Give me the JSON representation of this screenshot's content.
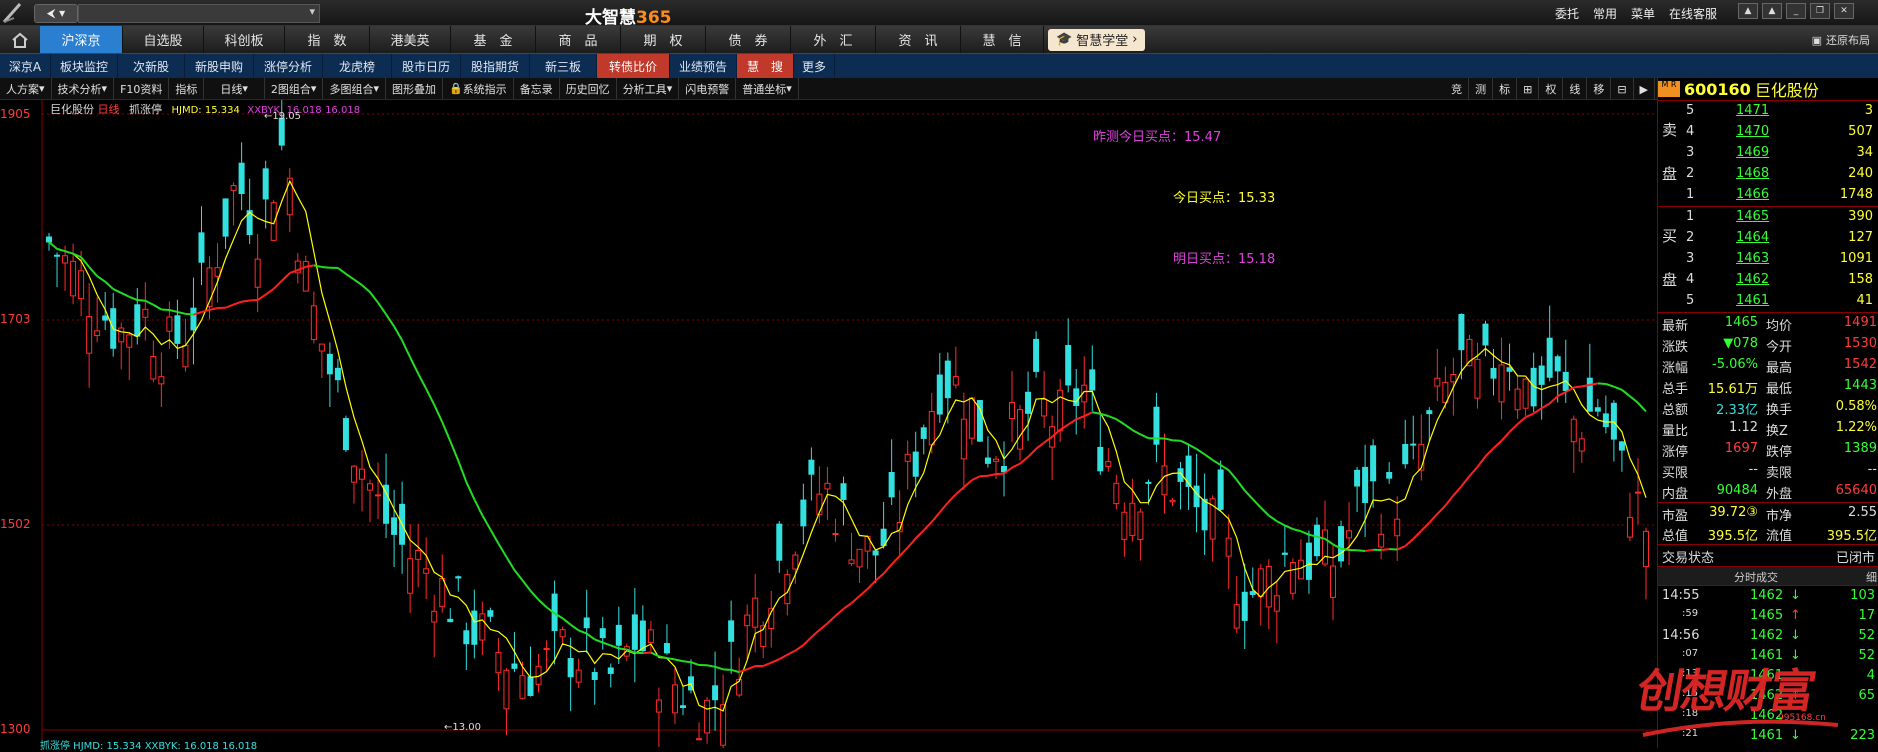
{
  "app": {
    "title": "大智慧365",
    "title_main": "大智慧",
    "title_suffix": "365",
    "window_controls": [
      "委托",
      "常用",
      "菜单",
      "在线客服"
    ],
    "restore_layout": "还原布局"
  },
  "menu": {
    "items": [
      "沪深京",
      "自选股",
      "科创板",
      "指　数",
      "港美英",
      "基　金",
      "商　品",
      "期　权",
      "债　券",
      "外　汇",
      "资　讯",
      "慧　信"
    ],
    "academy": "智慧学堂"
  },
  "subnav": {
    "items": [
      "深京A",
      "板块监控",
      "次新股",
      "新股申购",
      "涨停分析",
      "龙虎榜",
      "股市日历",
      "股指期货",
      "新三板",
      "转债比价",
      "业绩预告",
      "慧　搜",
      "更多"
    ]
  },
  "toolbar": {
    "items": [
      "人方案",
      "技术分析",
      "F10资料",
      "指标",
      "日线",
      "2图组合",
      "多图组合",
      "图形叠加",
      "系统指示",
      "备忘录",
      "历史回忆",
      "分析工具",
      "闪电预警",
      "普通坐标"
    ],
    "right_buttons": [
      "竞",
      "测",
      "标",
      "⊞",
      "权",
      "线",
      "移",
      "⊟",
      "▶"
    ]
  },
  "chart": {
    "stock_label": "巨化股份",
    "period": "日线",
    "indicator": "抓涨停",
    "hjmd": "HJMD: 15.334",
    "xxbyk": "XXBYK: 16.018",
    "xxbyk2": "16.018",
    "price_labels": [
      "1905",
      "1703",
      "1502",
      "1300"
    ],
    "high_marker": "19.05",
    "low_marker": "13.00",
    "note_yesterday": "昨测今日买点：15.47",
    "note_today": "今日买点：15.33",
    "note_tomorrow": "明日买点：15.18",
    "bottom_indicator": "抓涨停  HJMD: 15.334   XXBYK: 16.018   16.018",
    "colors": {
      "up": "#ff2a2a",
      "down": "#33e0e0",
      "ma_fast": "#ffff00",
      "ma_up": "#ff2020",
      "ma_down": "#22dd22"
    }
  },
  "chart_data": {
    "type": "candlestick",
    "ylim": [
      13.0,
      19.05
    ],
    "close_trend": [
      17.8,
      17.5,
      17.2,
      16.9,
      17.1,
      16.7,
      17.0,
      17.6,
      18.4,
      17.9,
      18.8,
      17.3,
      16.5,
      15.8,
      15.2,
      14.8,
      14.6,
      14.3,
      14.0,
      13.8,
      13.6,
      13.6,
      13.8,
      13.7,
      13.5,
      13.9,
      13.6,
      13.4,
      13.2,
      13.6,
      14.2,
      14.6,
      15.1,
      15.4,
      15.0,
      14.7,
      15.0,
      15.8,
      16.5,
      16.3,
      15.8,
      15.9,
      16.2,
      16.0,
      16.4,
      15.7,
      15.3,
      15.6,
      15.4,
      15.1,
      14.8,
      14.3,
      14.5,
      14.8,
      14.6,
      14.7,
      15.4,
      15.2,
      15.5,
      16.1,
      16.6,
      16.4,
      16.8,
      16.3,
      16.5,
      16.0,
      16.2,
      15.5,
      15.0
    ],
    "high": 19.05,
    "low": 13.0
  },
  "quote": {
    "code": "600160",
    "name": "巨化股份",
    "ask_label": [
      "卖",
      "盘"
    ],
    "bid_label": [
      "买",
      "盘"
    ],
    "asks": [
      {
        "level": "5",
        "price": "1471",
        "vol": "3"
      },
      {
        "level": "4",
        "price": "1470",
        "vol": "507"
      },
      {
        "level": "3",
        "price": "1469",
        "vol": "34"
      },
      {
        "level": "2",
        "price": "1468",
        "vol": "240"
      },
      {
        "level": "1",
        "price": "1466",
        "vol": "1748"
      }
    ],
    "bids": [
      {
        "level": "1",
        "price": "1465",
        "vol": "390"
      },
      {
        "level": "2",
        "price": "1464",
        "vol": "127"
      },
      {
        "level": "3",
        "price": "1463",
        "vol": "1091"
      },
      {
        "level": "4",
        "price": "1462",
        "vol": "158"
      },
      {
        "level": "5",
        "price": "1461",
        "vol": "41"
      }
    ],
    "stats": [
      {
        "l1": "最新",
        "v1": "1465",
        "c1": "green",
        "l2": "均价",
        "v2": "1491",
        "c2": "red"
      },
      {
        "l1": "涨跌",
        "v1": "▼078",
        "c1": "green",
        "l2": "今开",
        "v2": "1530",
        "c2": "red"
      },
      {
        "l1": "涨幅",
        "v1": "-5.06%",
        "c1": "green",
        "l2": "最高",
        "v2": "1542",
        "c2": "red"
      },
      {
        "l1": "总手",
        "v1": "15.61万",
        "c1": "yellow",
        "l2": "最低",
        "v2": "1443",
        "c2": "green"
      },
      {
        "l1": "总额",
        "v1": "2.33亿",
        "c1": "cyan",
        "l2": "换手",
        "v2": "0.58%",
        "c2": "yellow"
      },
      {
        "l1": "量比",
        "v1": "1.12",
        "c1": "white",
        "l2": "换Z",
        "v2": "1.22%",
        "c2": "yellow"
      },
      {
        "l1": "涨停",
        "v1": "1697",
        "c1": "red",
        "l2": "跌停",
        "v2": "1389",
        "c2": "green"
      },
      {
        "l1": "买限",
        "v1": "--",
        "c1": "white",
        "l2": "卖限",
        "v2": "--",
        "c2": "white"
      },
      {
        "l1": "内盘",
        "v1": "90484",
        "c1": "green",
        "l2": "外盘",
        "v2": "65640",
        "c2": "red"
      },
      {
        "l1": "市盈",
        "v1": "39.72③",
        "c1": "yellow",
        "l2": "市净",
        "v2": "2.55",
        "c2": "white"
      },
      {
        "l1": "总值",
        "v1": "395.5亿",
        "c1": "yellow",
        "l2": "流值",
        "v2": "395.5亿",
        "c2": "yellow"
      }
    ],
    "trade_status_label": "交易状态",
    "trade_status_value": "已闭市",
    "ticks_header": "分时成交",
    "ticks_header2": "细",
    "ticks": [
      {
        "time": "14:55",
        "price": "1462",
        "dir": "↓",
        "vol": "103",
        "pc": "green"
      },
      {
        "time": ":59",
        "price": "1465",
        "dir": "↑",
        "vol": "17",
        "pc": "red"
      },
      {
        "time": "14:56",
        "price": "1462",
        "dir": "↓",
        "vol": "52",
        "pc": "green"
      },
      {
        "time": ":07",
        "price": "1461",
        "dir": "↓",
        "vol": "52",
        "pc": "green"
      },
      {
        "time": ":13",
        "price": "1461",
        "dir": "",
        "vol": "4",
        "pc": "green"
      },
      {
        "time": ":15",
        "price": "1462",
        "dir": "↑",
        "vol": "65",
        "pc": "red"
      },
      {
        "time": ":18",
        "price": "1462",
        "dir": "",
        "vol": "",
        "pc": "green"
      },
      {
        "time": ":21",
        "price": "1461",
        "dir": "↓",
        "vol": "223",
        "pc": "green"
      }
    ]
  },
  "watermark": {
    "text": "创想财富",
    "url": "995168.cn"
  }
}
